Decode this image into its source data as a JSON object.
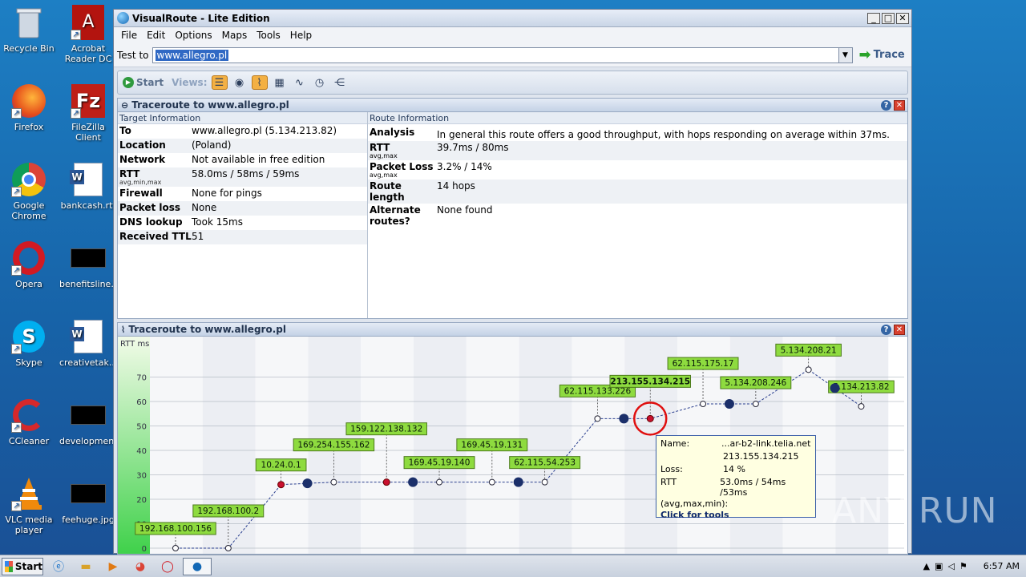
{
  "desktop": {
    "icons": [
      {
        "label": "Recycle Bin"
      },
      {
        "label": "Acrobat Reader DC"
      },
      {
        "label": "Firefox"
      },
      {
        "label": "FileZilla Client"
      },
      {
        "label": "Google Chrome"
      },
      {
        "label": "bankcash.rtf"
      },
      {
        "label": "Opera"
      },
      {
        "label": "benefitsline..."
      },
      {
        "label": "Skype"
      },
      {
        "label": "creativetak..."
      },
      {
        "label": "CCleaner"
      },
      {
        "label": "developmen..."
      },
      {
        "label": "VLC media player"
      },
      {
        "label": "feehuge.jpg"
      }
    ],
    "watermark": "ANY RUN"
  },
  "window": {
    "title": "VisualRoute - Lite Edition",
    "menu": [
      "File",
      "Edit",
      "Options",
      "Maps",
      "Tools",
      "Help"
    ],
    "test_label": "Test to",
    "test_value": "www.allegro.pl",
    "trace_label": "Trace",
    "toolbar": {
      "start": "Start",
      "views": "Views:"
    }
  },
  "info_panel": {
    "title": "Traceroute to www.allegro.pl",
    "target_head": "Target Information",
    "route_head": "Route Information",
    "target": [
      {
        "k": "To",
        "v": "www.allegro.pl (5.134.213.82)",
        "sub": ""
      },
      {
        "k": "Location",
        "v": "(Poland)",
        "sub": ""
      },
      {
        "k": "Network",
        "v": "Not available in free edition",
        "sub": ""
      },
      {
        "k": "RTT",
        "v": "58.0ms / 58ms / 59ms",
        "sub": "avg,min,max"
      },
      {
        "k": "Firewall",
        "v": "None for pings",
        "sub": ""
      },
      {
        "k": "Packet loss",
        "v": "None",
        "sub": ""
      },
      {
        "k": "DNS lookup",
        "v": "Took 15ms",
        "sub": ""
      },
      {
        "k": "Received TTL",
        "v": "51",
        "sub": ""
      }
    ],
    "route": [
      {
        "k": "Analysis",
        "v": "In general this route offers a good throughput, with hops responding on average within 37ms.",
        "sub": ""
      },
      {
        "k": "RTT",
        "v": "39.7ms / 80ms",
        "sub": "avg,max"
      },
      {
        "k": "Packet Loss",
        "v": "3.2% / 14%",
        "sub": "avg,max"
      },
      {
        "k": "Route length",
        "v": "14 hops",
        "sub": ""
      },
      {
        "k": "Alternate routes?",
        "v": "None found",
        "sub": ""
      }
    ]
  },
  "graph_panel": {
    "title": "Traceroute to www.allegro.pl",
    "y_unit": "RTT ms",
    "y_ticks": [
      "0",
      "10",
      "20",
      "30",
      "40",
      "50",
      "60",
      "70"
    ],
    "hops": [
      {
        "label": "192.168.100.156",
        "rtt": 0,
        "loss": false,
        "bold": false
      },
      {
        "label": "192.168.100.2",
        "rtt": 0,
        "loss": false,
        "bold": false
      },
      {
        "label": "10.24.0.1",
        "rtt": 26,
        "loss": true,
        "bold": false
      },
      {
        "label": "169.254.155.162",
        "rtt": 27,
        "loss": false,
        "bold": false
      },
      {
        "label": "159.122.138.132",
        "rtt": 27,
        "loss": true,
        "bold": false
      },
      {
        "label": "169.45.19.140",
        "rtt": 27,
        "loss": false,
        "bold": false
      },
      {
        "label": "169.45.19.131",
        "rtt": 27,
        "loss": false,
        "bold": false
      },
      {
        "label": "62.115.54.253",
        "rtt": 27,
        "loss": false,
        "bold": false
      },
      {
        "label": "62.115.133.226",
        "rtt": 53,
        "loss": false,
        "bold": false
      },
      {
        "label": "213.155.134.215",
        "rtt": 53,
        "loss": true,
        "bold": true
      },
      {
        "label": "62.115.175.17",
        "rtt": 59,
        "loss": false,
        "bold": false
      },
      {
        "label": "5.134.208.246",
        "rtt": 59,
        "loss": false,
        "bold": false
      },
      {
        "label": "5.134.208.21",
        "rtt": 73,
        "loss": false,
        "bold": false
      },
      {
        "label": "5.134.213.82",
        "rtt": 58,
        "loss": false,
        "bold": false
      }
    ],
    "tooltip": {
      "name_k": "Name:",
      "name_v": "...ar-b2-link.telia.net",
      "ip": "213.155.134.215",
      "loss_k": "Loss:",
      "loss_v": "14 %",
      "rtt_k": "RTT",
      "rtt_v": "53.0ms / 54ms /53ms",
      "rtt_sub": "(avg,max,min):",
      "click": "Click for tools"
    }
  },
  "taskbar": {
    "start": "Start",
    "clock": "6:57 AM"
  }
}
